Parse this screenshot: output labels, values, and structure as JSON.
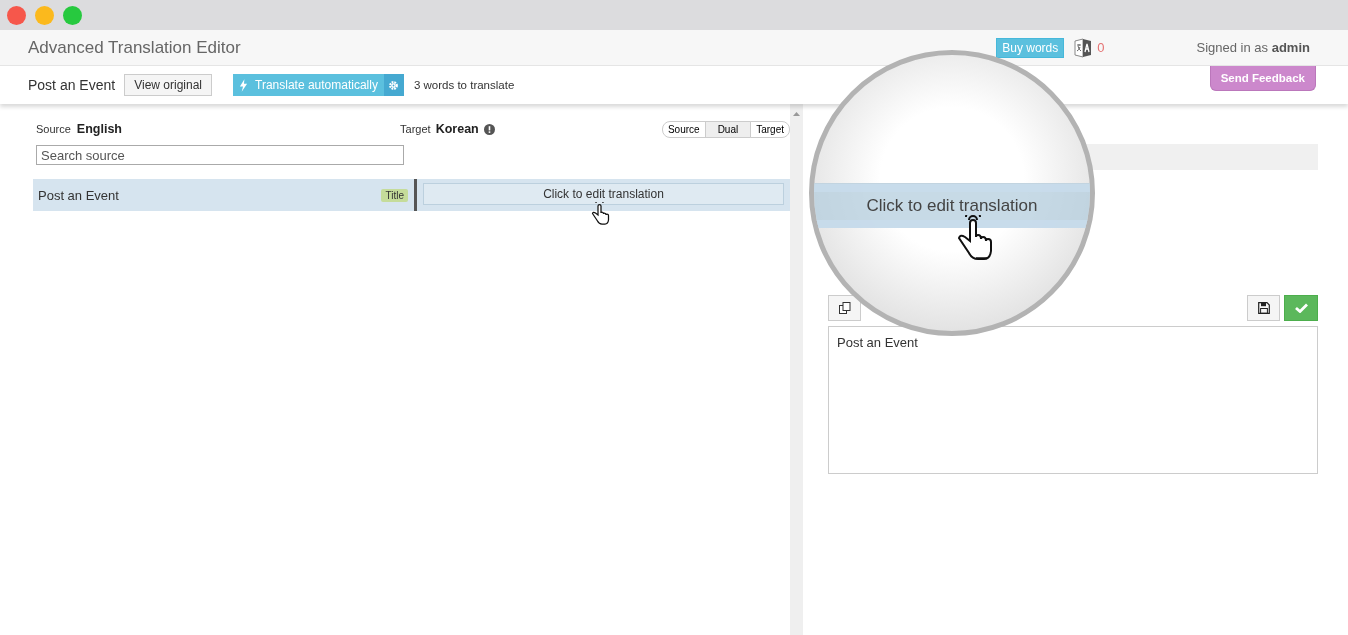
{
  "window": {
    "title": "Advanced Translation Editor"
  },
  "header": {
    "buy_words": "Buy words",
    "credits": "0",
    "signed_in": "Signed in as **admin**"
  },
  "toolbar": {
    "page": "Post an Event",
    "view_original": "View original",
    "translate_auto": "Translate automatically",
    "words_left": "3 words to translate",
    "feedback": "Send Feedback"
  },
  "source": {
    "label": "Source",
    "language": "English",
    "search": {
      "placeholder": "Search source"
    }
  },
  "target": {
    "label": "Target",
    "language": "Korean"
  },
  "view_modes": [
    {
      "label": "Source",
      "selected": false
    },
    {
      "label": "Dual",
      "selected": true
    },
    {
      "label": "Target",
      "selected": false
    }
  ],
  "rows": [
    {
      "source": "Post an Event",
      "tag": "Title",
      "target": "Click to edit translation",
      "selected": true
    }
  ],
  "editor": {
    "value": "Post an Event"
  },
  "magnifier": {
    "text": "Click to edit translation"
  }
}
